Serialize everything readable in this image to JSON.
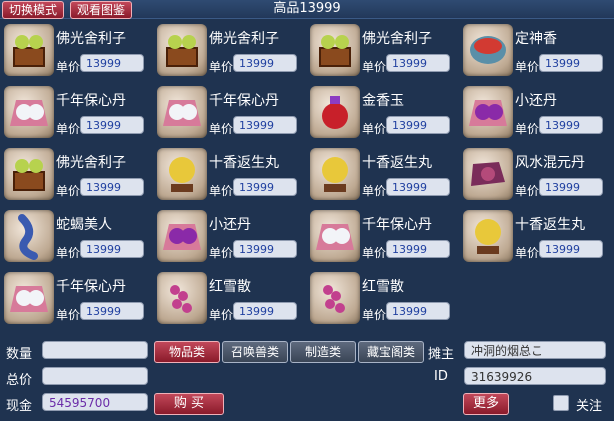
{
  "header": {
    "switch_mode": "切换模式",
    "view_catalog": "观看图鉴",
    "title": "高品13999"
  },
  "items": [
    {
      "name": "佛光舍利子",
      "price_label": "单价",
      "price": "13999",
      "icon": "relic-box-icon"
    },
    {
      "name": "佛光舍利子",
      "price_label": "单价",
      "price": "13999",
      "icon": "relic-box-icon"
    },
    {
      "name": "佛光舍利子",
      "price_label": "单价",
      "price": "13999",
      "icon": "relic-box-icon"
    },
    {
      "name": "定神香",
      "price_label": "单价",
      "price": "13999",
      "icon": "incense-bowl-icon"
    },
    {
      "name": "千年保心丹",
      "price_label": "单价",
      "price": "13999",
      "icon": "pill-cloth-icon"
    },
    {
      "name": "千年保心丹",
      "price_label": "单价",
      "price": "13999",
      "icon": "pill-cloth-icon"
    },
    {
      "name": "金香玉",
      "price_label": "单价",
      "price": "13999",
      "icon": "red-pouch-icon"
    },
    {
      "name": "小还丹",
      "price_label": "单价",
      "price": "13999",
      "icon": "purple-pill-icon"
    },
    {
      "name": "佛光舍利子",
      "price_label": "单价",
      "price": "13999",
      "icon": "relic-box-icon"
    },
    {
      "name": "十香返生丸",
      "price_label": "单价",
      "price": "13999",
      "icon": "golden-orb-icon"
    },
    {
      "name": "十香返生丸",
      "price_label": "单价",
      "price": "13999",
      "icon": "golden-orb-icon"
    },
    {
      "name": "风水混元丹",
      "price_label": "单价",
      "price": "13999",
      "icon": "feng-shui-pill-icon"
    },
    {
      "name": "蛇蝎美人",
      "price_label": "单价",
      "price": "13999",
      "icon": "centipede-icon"
    },
    {
      "name": "小还丹",
      "price_label": "单价",
      "price": "13999",
      "icon": "purple-pill-icon"
    },
    {
      "name": "千年保心丹",
      "price_label": "单价",
      "price": "13999",
      "icon": "pill-cloth-icon"
    },
    {
      "name": "十香返生丸",
      "price_label": "单价",
      "price": "13999",
      "icon": "golden-orb-icon"
    },
    {
      "name": "千年保心丹",
      "price_label": "单价",
      "price": "13999",
      "icon": "pill-cloth-icon"
    },
    {
      "name": "红雪散",
      "price_label": "单价",
      "price": "13999",
      "icon": "red-flower-icon"
    },
    {
      "name": "红雪散",
      "price_label": "单价",
      "price": "13999",
      "icon": "red-flower-icon"
    }
  ],
  "footer": {
    "quantity_label": "数量",
    "quantity_value": "",
    "total_label": "总价",
    "total_value": "",
    "cash_label": "现金",
    "cash_value": "54595700",
    "categories": [
      "物品类",
      "召唤兽类",
      "制造类",
      "藏宝阁类"
    ],
    "active_category": "物品类",
    "seller_label": "摊主",
    "seller_value": "冲洞的烟总こ",
    "id_label": "ID",
    "id_value": "31639926",
    "buy_label": "购 买",
    "more_label": "更多",
    "follow_label": "关注"
  },
  "colors": {
    "background": "#1f3350",
    "button_red": "#a8283a",
    "price_text": "#2040a0",
    "cash_text": "#6b2ca8"
  }
}
